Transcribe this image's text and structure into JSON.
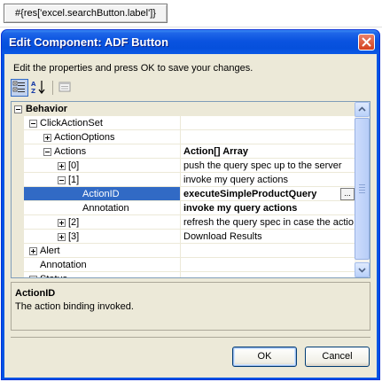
{
  "background_button": {
    "label": "#{res['excel.searchButton.label']}"
  },
  "dialog": {
    "title": "Edit Component: ADF Button",
    "instructions": "Edit the properties and press OK to save your changes."
  },
  "toolbar": {
    "icons": [
      "categorized-icon",
      "alphabetical-sort-icon",
      "property-pages-icon"
    ]
  },
  "property_grid": {
    "rows": [
      {
        "name": "Behavior",
        "value": "",
        "type": "category",
        "expander": "minus"
      },
      {
        "name": "ClickActionSet",
        "value": "",
        "expander": "minus"
      },
      {
        "name": "ActionOptions",
        "value": "",
        "expander": "plus"
      },
      {
        "name": "Actions",
        "value": "Action[] Array",
        "expander": "minus",
        "value_bold": true
      },
      {
        "name": "[0]",
        "value": "push the query spec up to the server",
        "expander": "plus"
      },
      {
        "name": "[1]",
        "value": "invoke my query actions",
        "expander": "minus"
      },
      {
        "name": "ActionID",
        "value": "executeSimpleProductQuery",
        "selected": true,
        "value_bold": true,
        "ellipsis": "..."
      },
      {
        "name": "Annotation",
        "value": "invoke my query actions",
        "value_bold": true
      },
      {
        "name": "[2]",
        "value": "refresh the query spec in case the actio",
        "expander": "plus"
      },
      {
        "name": "[3]",
        "value": "Download Results",
        "expander": "plus"
      },
      {
        "name": "Alert",
        "value": "",
        "expander": "plus"
      },
      {
        "name": "Annotation",
        "value": ""
      },
      {
        "name": "Status",
        "value": "",
        "expander": "plus"
      }
    ]
  },
  "description": {
    "title": "ActionID",
    "text": "The action binding invoked."
  },
  "buttons": {
    "ok": "OK",
    "cancel": "Cancel"
  },
  "colors": {
    "title_bar": "#0a53e0",
    "selection": "#316ac5",
    "client": "#ece9d8"
  }
}
